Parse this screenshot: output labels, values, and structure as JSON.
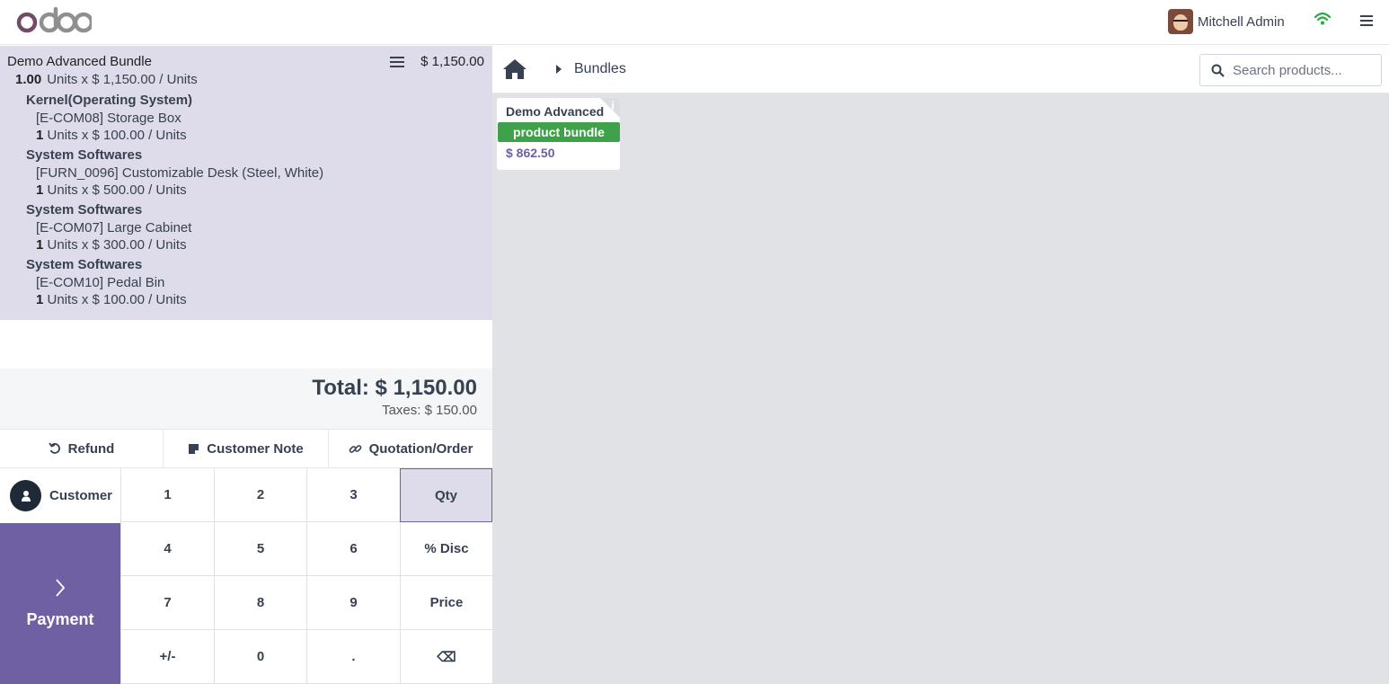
{
  "header": {
    "logo_text": "odoo",
    "user_name": "Mitchell Admin"
  },
  "order": {
    "line": {
      "product": "Demo Advanced Bundle",
      "price": "$ 1,150.00",
      "qty": "1.00",
      "qty_text": "Units x $ 1,150.00 / Units"
    },
    "groups": [
      {
        "name": "Kernel(Operating System)",
        "item": "[E-COM08] Storage Box",
        "qty": "1",
        "qty_text": "Units x $ 100.00 / Units"
      },
      {
        "name": "System Softwares",
        "item": "[FURN_0096] Customizable Desk (Steel, White)",
        "qty": "1",
        "qty_text": "Units x $ 500.00 / Units"
      },
      {
        "name": "System Softwares",
        "item": "[E-COM07] Large Cabinet",
        "qty": "1",
        "qty_text": "Units x $ 300.00 / Units"
      },
      {
        "name": "System Softwares",
        "item": "[E-COM10] Pedal Bin",
        "qty": "1",
        "qty_text": "Units x $ 100.00 / Units"
      }
    ],
    "total": "Total: $ 1,150.00",
    "taxes": "Taxes: $ 150.00"
  },
  "actions": {
    "refund": "Refund",
    "customer_note": "Customer Note",
    "quotation": "Quotation/Order"
  },
  "customer_label": "Customer",
  "payment_label": "Payment",
  "numpad": {
    "k1": "1",
    "k2": "2",
    "k3": "3",
    "qty": "Qty",
    "k4": "4",
    "k5": "5",
    "k6": "6",
    "disc": "% Disc",
    "k7": "7",
    "k8": "8",
    "k9": "9",
    "price": "Price",
    "sign": "+/-",
    "k0": "0",
    "dot": ".",
    "backspace": "⌫"
  },
  "catalog": {
    "breadcrumb": "Bundles",
    "search_placeholder": "Search products...",
    "products": [
      {
        "name": "Demo Advanced Bundle",
        "tag": "product bundle",
        "price": "$ 862.50"
      }
    ]
  },
  "colors": {
    "accent": "#6f5fa3",
    "order_bg": "#dedcea",
    "tag_green": "#3fa14a",
    "products_bg": "#e0e2e6",
    "wifi_green": "#28a745"
  },
  "icons": {
    "home": "home-icon",
    "search": "search-icon",
    "wifi": "wifi-icon",
    "menu": "hamburger-icon",
    "refund": "undo-icon",
    "note": "sticky-note-icon",
    "link": "link-icon",
    "user": "user-icon",
    "payment": "chevron-right-icon"
  }
}
